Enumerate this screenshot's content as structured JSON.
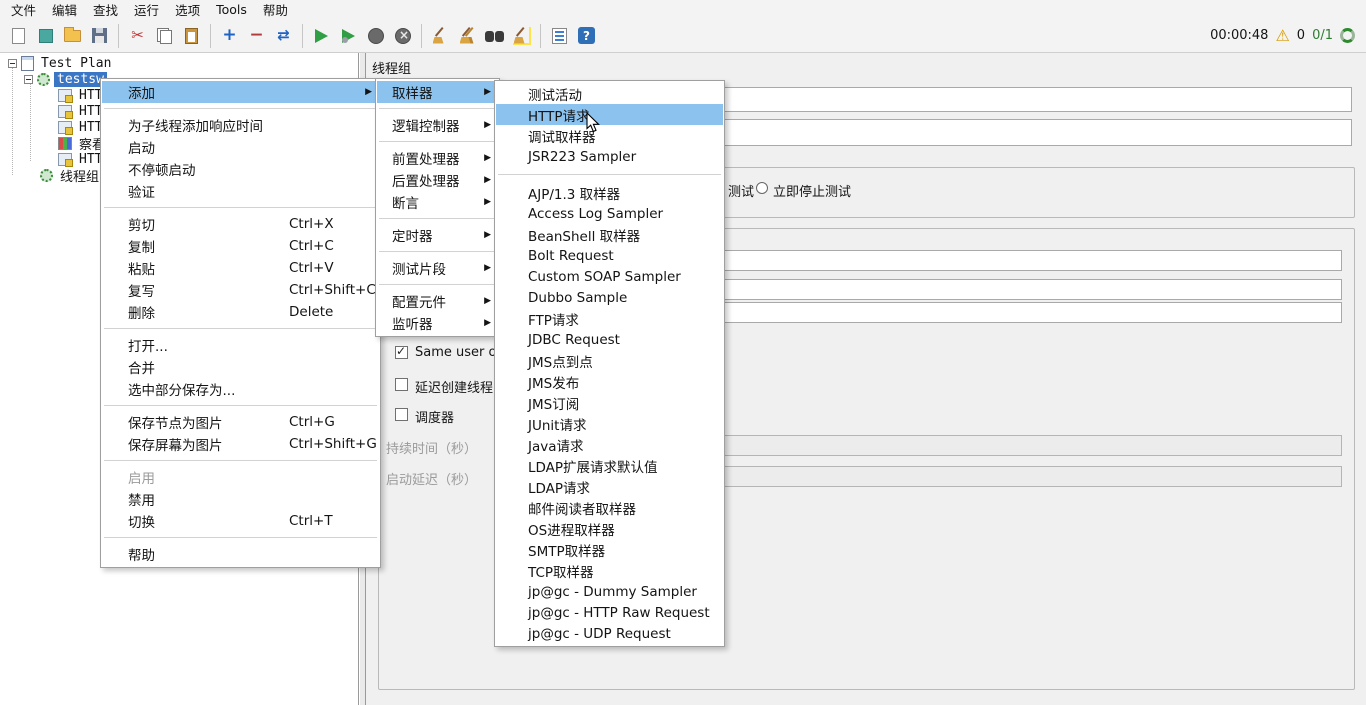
{
  "colors": {
    "menu_highlight": "#8cc2ee",
    "tree_selection": "#3b76c5",
    "start_green": "#2f9e44",
    "warning_yellow": "#d89b00"
  },
  "menubar": {
    "items": [
      "文件",
      "编辑",
      "查找",
      "运行",
      "选项",
      "Tools",
      "帮助"
    ]
  },
  "toolbar": {
    "buttons": [
      "new-file",
      "templates",
      "open",
      "save",
      "cut",
      "copy",
      "paste",
      "expand-all",
      "collapse-all",
      "toggle",
      "start",
      "start-no-pauses",
      "stop",
      "shutdown",
      "clear",
      "clear-all",
      "search",
      "search-reset",
      "function-helper",
      "help"
    ],
    "elapsed_time": "00:00:48",
    "warning_count": "0",
    "active_threads": "0/1"
  },
  "tree": {
    "items": [
      {
        "label": "Test Plan",
        "selected": false
      },
      {
        "label": "testsw",
        "selected": true
      },
      {
        "label": "HTT",
        "selected": false
      },
      {
        "label": "HTT",
        "selected": false
      },
      {
        "label": "HTT",
        "selected": false
      },
      {
        "label": "察看",
        "selected": false
      },
      {
        "label": "HTT",
        "selected": false
      },
      {
        "label": "线程组",
        "selected": false
      }
    ]
  },
  "main": {
    "title": "线程组",
    "name_value": "",
    "comments_value": "",
    "error_action": {
      "partial_label": "测试",
      "radio_label": "立即停止测试",
      "radio_selected": false
    },
    "props": {
      "field1_value": "",
      "field2_value": "",
      "field3_value": "",
      "same_user_label": "Same user on",
      "same_user_checked": true,
      "delay_label": "延迟创建线程",
      "delay_checked": false,
      "scheduler_label": "调度器",
      "scheduler_checked": false,
      "duration_label": "持续时间（秒）",
      "duration_value": "",
      "startup_label": "启动延迟（秒）",
      "startup_value": ""
    }
  },
  "menu_context": {
    "items": [
      {
        "label": "添加",
        "submenu": true,
        "highlighted": true
      },
      {
        "label": "为子线程添加响应时间"
      },
      {
        "label": "启动"
      },
      {
        "label": "不停顿启动"
      },
      {
        "label": "验证"
      },
      {
        "label": "剪切",
        "shortcut": "Ctrl+X"
      },
      {
        "label": "复制",
        "shortcut": "Ctrl+C"
      },
      {
        "label": "粘贴",
        "shortcut": "Ctrl+V"
      },
      {
        "label": "复写",
        "shortcut": "Ctrl+Shift+C"
      },
      {
        "label": "删除",
        "shortcut": "Delete"
      },
      {
        "label": "打开..."
      },
      {
        "label": "合并"
      },
      {
        "label": "选中部分保存为..."
      },
      {
        "label": "保存节点为图片",
        "shortcut": "Ctrl+G"
      },
      {
        "label": "保存屏幕为图片",
        "shortcut": "Ctrl+Shift+G"
      },
      {
        "label": "启用",
        "disabled": true
      },
      {
        "label": "禁用"
      },
      {
        "label": "切换",
        "shortcut": "Ctrl+T"
      },
      {
        "label": "帮助"
      }
    ]
  },
  "menu_add": {
    "items": [
      {
        "label": "取样器",
        "highlighted": true
      },
      {
        "label": "逻辑控制器"
      },
      {
        "label": "前置处理器"
      },
      {
        "label": "后置处理器"
      },
      {
        "label": "断言"
      },
      {
        "label": "定时器"
      },
      {
        "label": "测试片段"
      },
      {
        "label": "配置元件"
      },
      {
        "label": "监听器"
      }
    ]
  },
  "menu_sampler": {
    "items": [
      {
        "label": "测试活动"
      },
      {
        "label": "HTTP请求",
        "highlighted": true
      },
      {
        "label": "调试取样器"
      },
      {
        "label": "JSR223 Sampler"
      },
      {
        "label": "AJP/1.3 取样器"
      },
      {
        "label": "Access Log Sampler"
      },
      {
        "label": "BeanShell 取样器"
      },
      {
        "label": "Bolt Request"
      },
      {
        "label": "Custom SOAP Sampler"
      },
      {
        "label": "Dubbo Sample"
      },
      {
        "label": "FTP请求"
      },
      {
        "label": "JDBC Request"
      },
      {
        "label": "JMS点到点"
      },
      {
        "label": "JMS发布"
      },
      {
        "label": "JMS订阅"
      },
      {
        "label": "JUnit请求"
      },
      {
        "label": "Java请求"
      },
      {
        "label": "LDAP扩展请求默认值"
      },
      {
        "label": "LDAP请求"
      },
      {
        "label": "邮件阅读者取样器"
      },
      {
        "label": "OS进程取样器"
      },
      {
        "label": "SMTP取样器"
      },
      {
        "label": "TCP取样器"
      },
      {
        "label": "jp@gc - Dummy Sampler"
      },
      {
        "label": "jp@gc - HTTP Raw Request"
      },
      {
        "label": "jp@gc - UDP Request"
      }
    ]
  }
}
